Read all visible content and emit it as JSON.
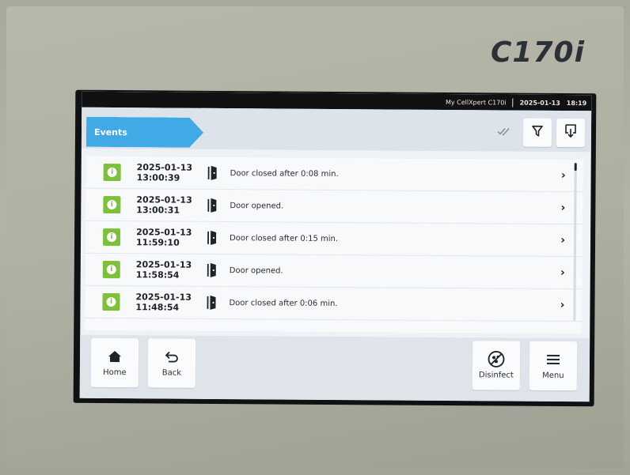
{
  "device": {
    "model": "C170i"
  },
  "status_bar": {
    "device_name": "My CellXpert C170i",
    "date": "2025-01-13",
    "time": "18:19"
  },
  "header": {
    "title": "Events"
  },
  "events": [
    {
      "date": "2025-01-13",
      "time": "13:00:39",
      "message": "Door closed after 0:08 min."
    },
    {
      "date": "2025-01-13",
      "time": "13:00:31",
      "message": "Door opened."
    },
    {
      "date": "2025-01-13",
      "time": "11:59:10",
      "message": "Door closed after 0:15 min."
    },
    {
      "date": "2025-01-13",
      "time": "11:58:54",
      "message": "Door opened."
    },
    {
      "date": "2025-01-13",
      "time": "11:48:54",
      "message": "Door closed after 0:06 min."
    }
  ],
  "footer": {
    "home_label": "Home",
    "back_label": "Back",
    "disinfect_label": "Disinfect",
    "menu_label": "Menu"
  },
  "icons": {
    "event_type": "info-icon",
    "event_category": "door-icon",
    "row_action": "chevron-right-icon"
  },
  "colors": {
    "accent": "#42a9e7",
    "info_green": "#7ec03a",
    "status_bar": "#111111"
  }
}
